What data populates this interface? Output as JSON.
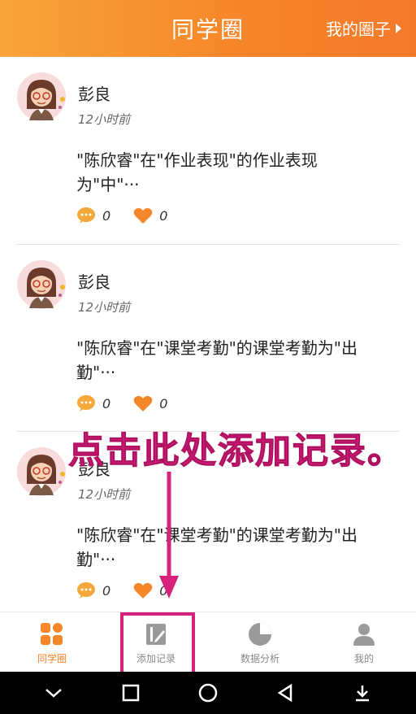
{
  "header": {
    "title": "同学圈",
    "right_label": "我的圈子"
  },
  "posts": [
    {
      "author": "彭良",
      "time": "12小时前",
      "content": "\"陈欣睿\"在\"作业表现\"的作业表现为\"中\"···",
      "comments": "0",
      "likes": "0"
    },
    {
      "author": "彭良",
      "time": "12小时前",
      "content": "\"陈欣睿\"在\"课堂考勤\"的课堂考勤为\"出勤\"···",
      "comments": "0",
      "likes": "0"
    },
    {
      "author": "彭良",
      "time": "12小时前",
      "content": "\"陈欣睿\"在\"课堂考勤\"的课堂考勤为\"出勤\"···",
      "comments": "0",
      "likes": "0"
    }
  ],
  "overlay": {
    "text": "点击此处添加记录。"
  },
  "tabs": [
    {
      "label": "同学圈",
      "icon": "grid-icon"
    },
    {
      "label": "添加记录",
      "icon": "edit-note-icon"
    },
    {
      "label": "数据分析",
      "icon": "pie-chart-icon"
    },
    {
      "label": "我的",
      "icon": "person-icon"
    }
  ],
  "colors": {
    "accent": "#f5862a",
    "annotation": "#d6227b"
  }
}
